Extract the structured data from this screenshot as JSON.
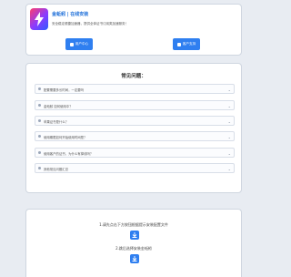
{
  "header": {
    "title": "金蚯蚓 | 在线安装",
    "desc": "安全稳定便捷加速器，提供全体证书订阅类加速服务！"
  },
  "buttons": {
    "user_center": "用户中心",
    "support": "客户支持"
  },
  "faq": {
    "title": "常见问题：",
    "items": [
      "配置需要多长时间，一定要吗",
      "金蚯蚓 如何使用中？",
      "苹果证书是什么？",
      "使用期限如何开始使用时间是？",
      "使用客户的证书，为什么有掉线吗？",
      "其他常见问题汇总"
    ]
  },
  "steps": {
    "step1": "1.请先点击下方按钮根据提示安装配置文件",
    "step2": "2.跳后选择安装金蚯蚓"
  },
  "colors": {
    "accent": "#2f7ff0",
    "background": "#e8ecf2"
  }
}
